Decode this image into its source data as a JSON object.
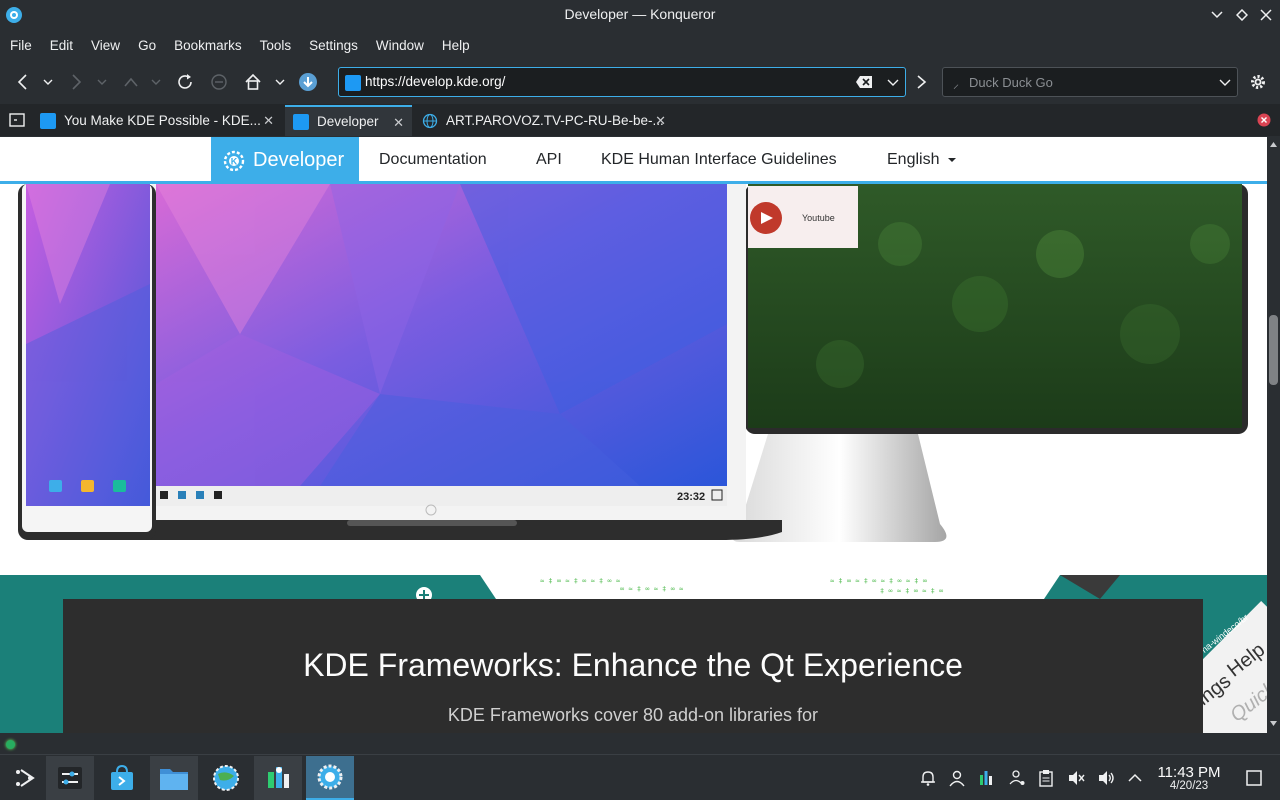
{
  "window": {
    "title": "Developer — Konqueror"
  },
  "menubar": {
    "items": [
      "File",
      "Edit",
      "View",
      "Go",
      "Bookmarks",
      "Tools",
      "Settings",
      "Window",
      "Help"
    ]
  },
  "toolbar": {
    "url": "https://develop.kde.org/",
    "search_placeholder": "Duck Duck Go",
    "search_prefix": "⸝"
  },
  "tabs": [
    {
      "label": "You Make KDE Possible - KDE...",
      "active": false
    },
    {
      "label": "Developer",
      "active": true
    },
    {
      "label": "ART.PAROVOZ.TV-PC-RU-Be-be-...",
      "active": false
    }
  ],
  "page": {
    "nav": {
      "brand": "Developer",
      "links": [
        "Documentation",
        "API",
        "KDE Human Interface Guidelines",
        "English"
      ]
    },
    "hero": {
      "laptop_clock": "23:32",
      "monitor_tile_label": "Youtube"
    },
    "section": {
      "headline": "KDE Frameworks: Enhance the Qt Experience",
      "subtext": "KDE Frameworks cover 80 add-on libraries for",
      "side_words": [
        "Help",
        "Quick",
        "ings",
        "na-windeco/br"
      ]
    }
  },
  "taskbar": {
    "clock_time": "11:43 PM",
    "clock_date": "4/20/23"
  },
  "colors": {
    "accent": "#3daee9",
    "teal": "#1b8079",
    "dark_card": "#2d2d2d"
  }
}
